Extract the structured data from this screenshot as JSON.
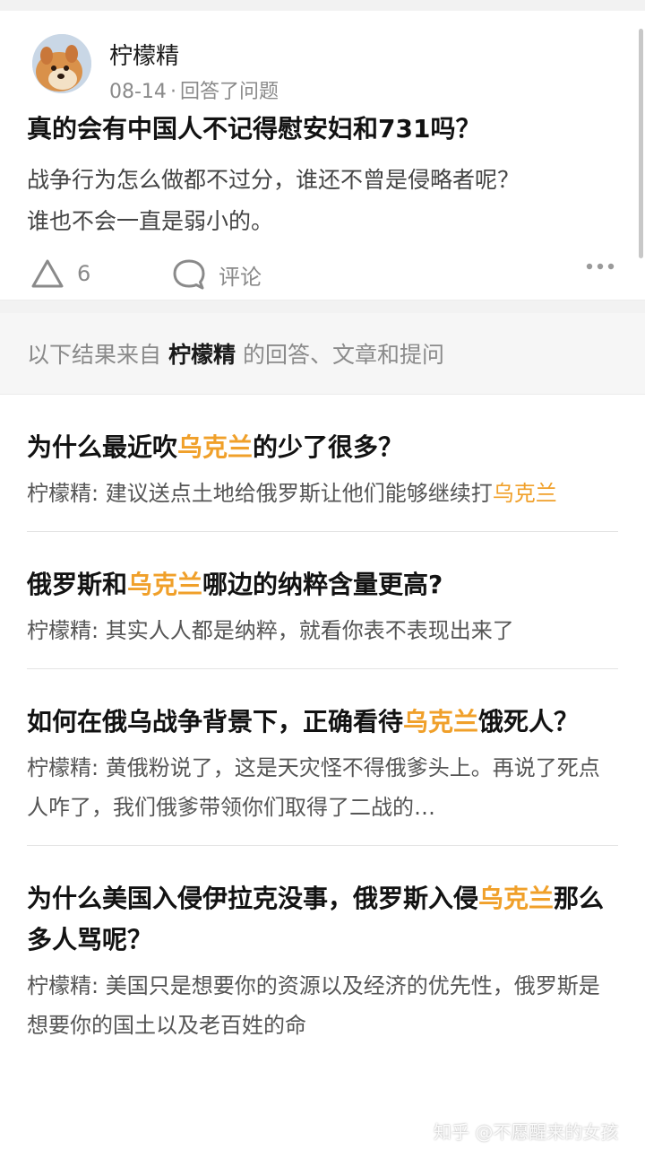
{
  "answer_card": {
    "author": "柠檬精",
    "date": "08-14",
    "action": "回答了问题",
    "title": "真的会有中国人不记得慰安妇和731吗？",
    "excerpt_line1": "战争行为怎么做都不过分，谁还不曾是侵略者呢？",
    "excerpt_line2": "谁也不会一直是弱小的。",
    "vote_count": "6",
    "comment_label": "评论"
  },
  "source": {
    "prefix": "以下结果来自",
    "name": "柠檬精",
    "suffix": "的回答、文章和提问"
  },
  "results": [
    {
      "title_before": "为什么最近吹",
      "title_hl": "乌克兰",
      "title_after": "的少了很多？",
      "snippet_before": "柠檬精: 建议送点土地给俄罗斯让他们能够继续打",
      "snippet_hl": "乌克兰",
      "snippet_after": ""
    },
    {
      "title_before": "俄罗斯和",
      "title_hl": "乌克兰",
      "title_after": "哪边的纳粹含量更高?",
      "snippet_before": "柠檬精: 其实人人都是纳粹，就看你表不表现出来了",
      "snippet_hl": "",
      "snippet_after": ""
    },
    {
      "title_before": "如何在俄乌战争背景下，正确看待",
      "title_hl": "乌克兰",
      "title_after": "饿死人？",
      "snippet_before": "柠檬精: 黄俄粉说了，这是天灾怪不得俄爹头上。再说了死点人咋了，我们俄爹带领你们取得了二战的…",
      "snippet_hl": "",
      "snippet_after": ""
    },
    {
      "title_before": "为什么美国入侵伊拉克没事，俄罗斯入侵",
      "title_hl": "乌克兰",
      "title_after": "那么多人骂呢？",
      "snippet_before": "柠檬精: 美国只是想要你的资源以及经济的优先性，俄罗斯是想要你的国土以及老百姓的命",
      "snippet_hl": "",
      "snippet_after": ""
    }
  ],
  "watermark": "知乎 @不愿醒来的女孩",
  "colors": {
    "highlight": "#f0a02a",
    "background": "#ffffff",
    "section_bg": "#f6f6f6",
    "muted_text": "#8a8a8a"
  },
  "icons": [
    "avatar",
    "upvote-icon",
    "comment-icon",
    "more-icon"
  ]
}
